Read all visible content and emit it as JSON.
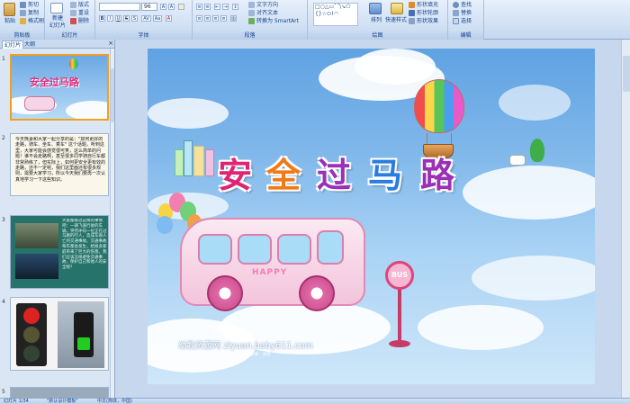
{
  "ribbon": {
    "groups": {
      "clipboard": "剪贴板",
      "slides": "幻灯片",
      "font": "字体",
      "paragraph": "段落",
      "drawing": "绘图",
      "editing": "编辑"
    },
    "clipboard": {
      "paste": "粘贴",
      "cut": "剪切",
      "copy": "复制",
      "format_painter": "格式刷"
    },
    "slides": {
      "new_slide_1": "新建",
      "new_slide_2": "幻灯片",
      "layout": "版式",
      "reset": "重设",
      "delete": "删除"
    },
    "font": {
      "font_name": "",
      "font_size": "96",
      "grow": "A",
      "shrink": "A",
      "bold": "B",
      "italic": "I",
      "underline": "U",
      "strike": "S",
      "shadow": "S",
      "spacing": "AV",
      "case": "Aa",
      "color": "A"
    },
    "paragraph": {
      "text_direction": "文字方向",
      "align_text": "对齐文本",
      "smartart": "转换为 SmartArt"
    },
    "drawing": {
      "shapes": "□○△▭⌒\\↘⬠\n{}☆⬭⌇◠",
      "arrange": "排列",
      "quick_styles": "快速样式",
      "fill": "形状填充",
      "outline": "形状轮廓",
      "effects": "形状效果"
    },
    "editing": {
      "find": "查找",
      "replace": "替换",
      "select": "选择"
    }
  },
  "left_pane": {
    "tab_slides": "幻灯片",
    "tab_outline": "大纲",
    "close": "×",
    "thumbs": [
      {
        "num": "1",
        "title": "安全过马路"
      },
      {
        "num": "2",
        "text": "今天熊妻和大家一起分享的是：\"如何更好的走路，骑车、坐车、乘车\" 这个话题，听到这里，大家可能会感觉很可笑，这么简单的问题！谁不会走路啊，甚至很多同学骑自行车都非常熟练了，但实际上，如何更安全更有效的走路，还不一定呢，我们这里面还有很多规则，需要大家学习，所以今天我们要再一次认真地学习一下这些知识。"
      },
      {
        "num": "3",
        "text": "大家都看过这样的事情吧：一辆飞速行驶的车辆，突然冲向一位正在过马路的行人，造成车毁人亡的交通事故。交通事故每年都会发生，给很多家庭带来了巨大的伤害。我们应该怎样避免交通事故，保护自己和他人的安全呢？"
      },
      {
        "num": "4"
      },
      {
        "num": "5"
      }
    ]
  },
  "slide": {
    "title_chars": [
      "安",
      "全",
      "过",
      "马",
      "路"
    ],
    "title_colors": [
      "#e02474",
      "#f07a16",
      "#9b2fb5",
      "#2a7de0",
      "#9b2fb5"
    ],
    "bus_sign": "HAPPY",
    "stop_sign": "BUS",
    "watermark": "幼教资源网 ziyuan.baby611.com",
    "watermark_sub": "PPT课件 · FLASH课件 · 教学故事 · 试卷"
  },
  "status": {
    "slide_of": "幻灯片 1/34",
    "theme": "\"默认设计模板\"",
    "lang": "中文(简体，中国)"
  }
}
